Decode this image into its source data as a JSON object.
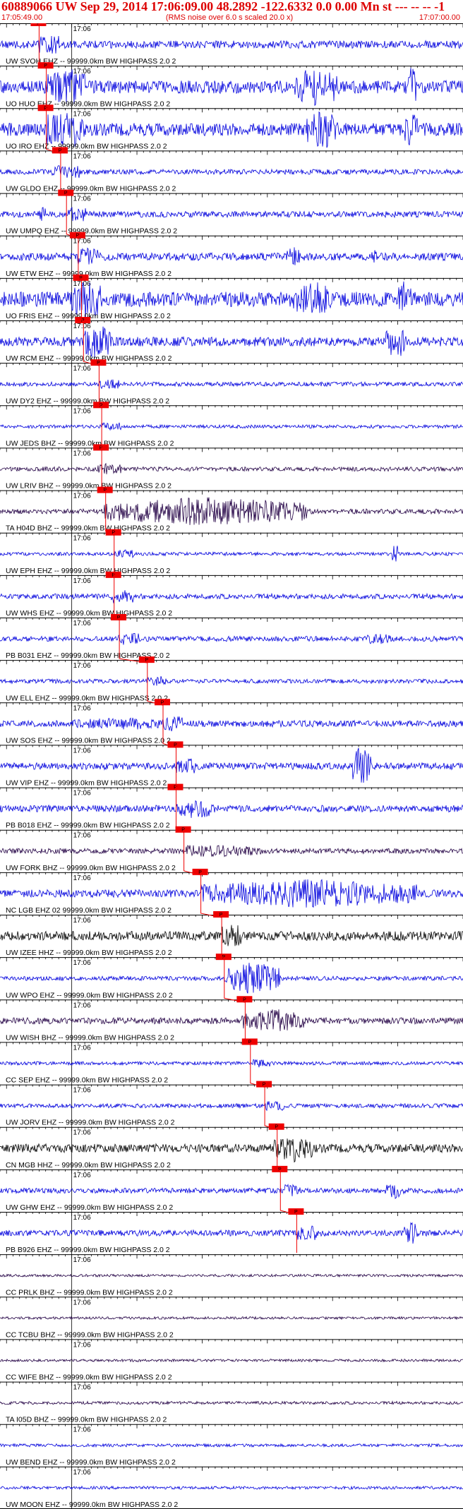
{
  "header": {
    "title": "60889066 UW Sep 29, 2014 17:06:09.00   48.2892 -122.6332  0.0 0.00 Mn st --- -- --   -1",
    "start_time": "17:05:49.00",
    "subtitle": "(RMS noise over 6.0 s scaled 20.0 x)",
    "end_time": "17:07:00.00"
  },
  "chart_data": {
    "type": "line",
    "x_unit": "s",
    "x_range": [
      "17:05:49.00",
      "17:07:00.00"
    ],
    "minute_tick_label": "17:06",
    "grid": true,
    "pick_label": "P",
    "traces": [
      {
        "label": "UW SVOH EHZ -- 99999.0km BW  HIGHPASS  2.0  2",
        "color": "#0000dd",
        "pick_s": 6.0,
        "amp": 0.18,
        "bursts": []
      },
      {
        "label": "UO HUO EHZ -- 99999.0km BW  HIGHPASS  2.0  2",
        "color": "#0000dd",
        "pick_s": 7.1,
        "amp": 0.3,
        "bursts": [
          [
            9,
            13,
            1.0
          ],
          [
            45,
            52,
            1.0
          ],
          [
            62,
            64,
            1.0
          ]
        ]
      },
      {
        "label": "UO IRO EHZ -- 99999.0km BW  HIGHPASS  2.0  2",
        "color": "#0000dd",
        "pick_s": 7.1,
        "amp": 0.3,
        "bursts": [
          [
            8,
            13,
            1.0
          ],
          [
            47,
            52,
            1.0
          ],
          [
            62,
            64,
            1.0
          ]
        ]
      },
      {
        "label": "UW GLDO EHZ -- 99999.0km BW  HIGHPASS  2.0  2",
        "color": "#0000dd",
        "pick_s": 9.3,
        "amp": 0.12,
        "bursts": [
          [
            8,
            10,
            0.3
          ]
        ]
      },
      {
        "label": "UW UMPQ EHZ -- 99999.0km BW  HIGHPASS  2.0  2",
        "color": "#0000dd",
        "pick_s": 10.2,
        "amp": 0.14,
        "bursts": [
          [
            6,
            7,
            0.5
          ]
        ]
      },
      {
        "label": "UW ETW EHZ -- 99999.0km BW  HIGHPASS  2.0  2",
        "color": "#0000dd",
        "pick_s": 12.0,
        "amp": 0.18,
        "bursts": [
          [
            44,
            46,
            0.5
          ],
          [
            57,
            58,
            0.4
          ]
        ]
      },
      {
        "label": "UO FRIS EHZ -- 99999.0km BW  HIGHPASS  2.0  2",
        "color": "#0000dd",
        "pick_s": 12.5,
        "amp": 0.35,
        "bursts": [
          [
            11,
            15,
            1.0
          ],
          [
            45,
            51,
            0.9
          ],
          [
            61,
            63,
            0.9
          ]
        ]
      },
      {
        "label": "UW RCM EHZ -- 99999.0km BW  HIGHPASS  2.0  2",
        "color": "#0000dd",
        "pick_s": 12.8,
        "amp": 0.22,
        "bursts": [
          [
            13,
            17,
            0.9
          ],
          [
            59,
            63,
            0.8
          ]
        ]
      },
      {
        "label": "UW DY2 EHZ -- 99999.0km BW  HIGHPASS  2.0  2",
        "color": "#0000dd",
        "pick_s": 15.2,
        "amp": 0.1,
        "bursts": []
      },
      {
        "label": "UW JEDS BHZ -- 99999.0km BW  HIGHPASS  2.0  2",
        "color": "#0000dd",
        "pick_s": 15.6,
        "amp": 0.08,
        "bursts": []
      },
      {
        "label": "UW LRIV BHZ -- 99999.0km BW  HIGHPASS  2.0  2",
        "color": "#220044",
        "pick_s": 15.6,
        "amp": 0.1,
        "bursts": [
          [
            15,
            17,
            0.3
          ]
        ]
      },
      {
        "label": "TA H04D BHZ -- 99999.0km BW  HIGHPASS  2.0  2",
        "color": "#220044",
        "pick_s": 16.2,
        "amp": 0.12,
        "bursts": [
          [
            16,
            47,
            0.7
          ]
        ]
      },
      {
        "label": "UW EPH EHZ -- 99999.0km BW  HIGHPASS  2.0  2",
        "color": "#0000dd",
        "pick_s": 17.5,
        "amp": 0.08,
        "bursts": [
          [
            60,
            61,
            0.6
          ]
        ]
      },
      {
        "label": "UW WHS EHZ -- 99999.0km BW  HIGHPASS  2.0  2",
        "color": "#0000dd",
        "pick_s": 17.5,
        "amp": 0.12,
        "bursts": [
          [
            17,
            18,
            0.4
          ]
        ]
      },
      {
        "label": "PB B031 EHZ -- 99999.0km BW  HIGHPASS  2.0  2",
        "color": "#0000dd",
        "pick_s": 18.3,
        "amp": 0.12,
        "bursts": [
          [
            18,
            21,
            0.3
          ],
          [
            56,
            60,
            0.3
          ]
        ]
      },
      {
        "label": "UW ELL EHZ -- 99999.0km BW  HIGHPASS  2.0  2",
        "color": "#0000dd",
        "pick_s": 22.6,
        "amp": 0.1,
        "bursts": []
      },
      {
        "label": "UW SOS EHZ -- 99999.0km BW  HIGHPASS  2.0  2",
        "color": "#0000dd",
        "pick_s": 25.0,
        "amp": 0.15,
        "bursts": [
          [
            11,
            27,
            0.3
          ]
        ]
      },
      {
        "label": "UW VIP EHZ -- 99999.0km BW  HIGHPASS  2.0  2",
        "color": "#0000dd",
        "pick_s": 27.0,
        "amp": 0.16,
        "bursts": [
          [
            54,
            57,
            1.0
          ]
        ]
      },
      {
        "label": "PB B018 EHZ -- 99999.0km BW  HIGHPASS  2.0  2",
        "color": "#0000dd",
        "pick_s": 27.0,
        "amp": 0.16,
        "bursts": [
          [
            27,
            33,
            0.5
          ]
        ]
      },
      {
        "label": "UW FORK BHZ -- 99999.0km BW  HIGHPASS  2.0  2",
        "color": "#220044",
        "pick_s": 28.2,
        "amp": 0.12,
        "bursts": [
          [
            28,
            40,
            0.3
          ]
        ]
      },
      {
        "label": "NC LGB EHZ 02 99999.0km BW  HIGHPASS  2.0  2",
        "color": "#0000dd",
        "pick_s": 30.8,
        "amp": 0.18,
        "bursts": [
          [
            31,
            64,
            0.7
          ]
        ]
      },
      {
        "label": "UW IZEE HHZ -- 99999.0km BW  HIGHPASS  2.0  2",
        "color": "#000000",
        "pick_s": 34.0,
        "amp": 0.22,
        "bursts": []
      },
      {
        "label": "UW WPO EHZ -- 99999.0km BW  HIGHPASS  2.0  2",
        "color": "#0000dd",
        "pick_s": 34.4,
        "amp": 0.1,
        "bursts": [
          [
            35,
            43,
            0.8
          ]
        ]
      },
      {
        "label": "UW WISH BHZ -- 99999.0km BW  HIGHPASS  2.0  2",
        "color": "#220044",
        "pick_s": 37.6,
        "amp": 0.15,
        "bursts": [
          [
            37,
            47,
            0.6
          ]
        ]
      },
      {
        "label": "CC SEP EHZ -- 99999.0km BW  HIGHPASS  2.0  2",
        "color": "#0000dd",
        "pick_s": 38.4,
        "amp": 0.08,
        "bursts": []
      },
      {
        "label": "UW JORV EHZ -- 99999.0km BW  HIGHPASS  2.0  2",
        "color": "#0000dd",
        "pick_s": 40.6,
        "amp": 0.1,
        "bursts": []
      },
      {
        "label": "CN MGB HHZ -- 99999.0km BW  HIGHPASS  2.0  2",
        "color": "#000000",
        "pick_s": 42.5,
        "amp": 0.2,
        "bursts": [
          [
            42,
            48,
            0.7
          ]
        ]
      },
      {
        "label": "UW GHW EHZ -- 99999.0km BW  HIGHPASS  2.0  2",
        "color": "#0000dd",
        "pick_s": 43.0,
        "amp": 0.12,
        "bursts": [
          [
            59,
            62,
            0.4
          ]
        ]
      },
      {
        "label": "PB B926 EHZ -- 99999.0km BW  HIGHPASS  2.0  2",
        "color": "#0000dd",
        "pick_s": 45.5,
        "amp": 0.14,
        "bursts": [
          [
            62,
            64,
            0.6
          ]
        ]
      },
      {
        "label": "CC PRLK BHZ -- 99999.0km BW  HIGHPASS  2.0  2",
        "color": "#220044",
        "pick_s": null,
        "amp": 0.06,
        "bursts": []
      },
      {
        "label": "CC TCBU BHZ -- 99999.0km BW  HIGHPASS  2.0  2",
        "color": "#220044",
        "pick_s": null,
        "amp": 0.06,
        "bursts": []
      },
      {
        "label": "CC WIFE BHZ -- 99999.0km BW  HIGHPASS  2.0  2",
        "color": "#220044",
        "pick_s": null,
        "amp": 0.06,
        "bursts": []
      },
      {
        "label": "TA I05D BHZ -- 99999.0km BW  HIGHPASS  2.0  2",
        "color": "#220044",
        "pick_s": null,
        "amp": 0.07,
        "bursts": []
      },
      {
        "label": "UW BEND EHZ -- 99999.0km BW  HIGHPASS  2.0  2",
        "color": "#0000dd",
        "pick_s": null,
        "amp": 0.07,
        "bursts": []
      },
      {
        "label": "UW MOON EHZ -- 99999.0km BW  HIGHPASS  2.0  2",
        "color": "#0000dd",
        "pick_s": null,
        "amp": 0.07,
        "bursts": []
      }
    ]
  }
}
